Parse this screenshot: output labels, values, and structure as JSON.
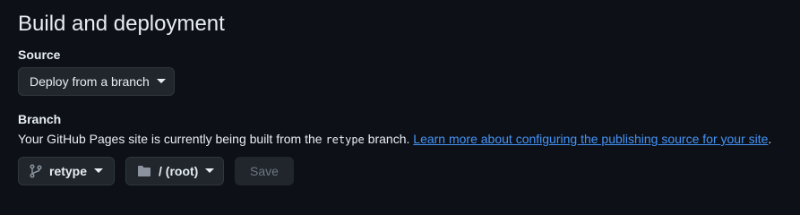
{
  "section": {
    "title": "Build and deployment",
    "source_label": "Source",
    "source_value": "Deploy from a branch",
    "branch_label": "Branch",
    "description_prefix": "Your GitHub Pages site is currently being built from the ",
    "description_branch": "retype",
    "description_suffix": " branch. ",
    "learn_more_link": "Learn more about configuring the publishing source for your site",
    "description_end": ".",
    "branch_value": "retype",
    "folder_value": "/ (root)",
    "save_label": "Save"
  },
  "icons": {
    "branch": "git-branch-icon",
    "folder": "folder-icon",
    "caret": "caret-down-icon"
  }
}
